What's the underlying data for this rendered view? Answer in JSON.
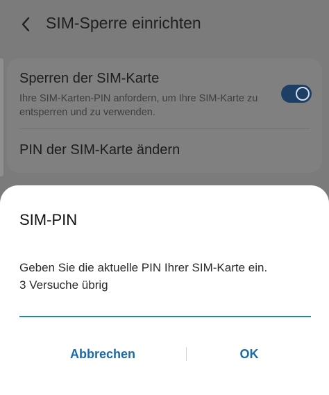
{
  "header": {
    "back_icon": "chevron-left-icon",
    "title": "SIM-Sperre einrichten"
  },
  "settings": {
    "lock": {
      "title": "Sperren der SIM-Karte",
      "description": "Ihre SIM-Karten-PIN anfordern, um Ihre SIM-Karte zu entsperren und zu verwenden.",
      "toggle_on": true
    },
    "change_pin": {
      "label": "PIN der SIM-Karte ändern"
    }
  },
  "dialog": {
    "title": "SIM-PIN",
    "message_line1": "Geben Sie die aktuelle PIN Ihrer SIM-Karte ein.",
    "message_line2": "3 Versuche übrig",
    "input_value": "",
    "cancel_label": "Abbrechen",
    "ok_label": "OK"
  },
  "colors": {
    "accent": "#1a6aa6",
    "input_underline": "#1a8ea1",
    "toggle_track": "#1d3f66"
  }
}
